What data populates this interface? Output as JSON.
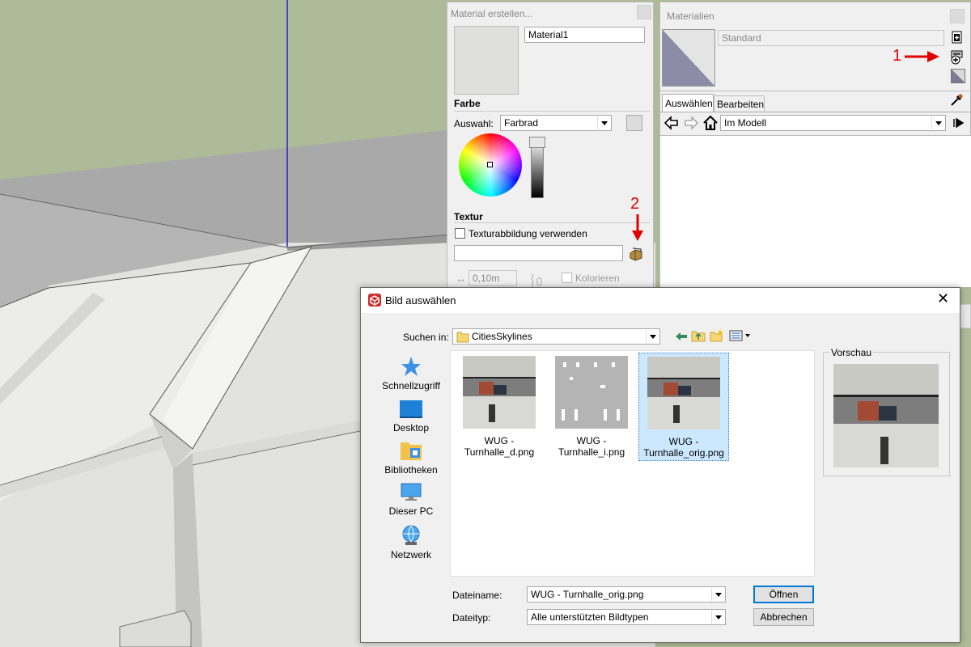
{
  "colors": {
    "viewport_sky": "#aebb98",
    "accent": "#0078d7",
    "annotation": "#e00000"
  },
  "create_material": {
    "title": "Material erstellen...",
    "name_value": "Material1",
    "color_section": "Farbe",
    "selection_label": "Auswahl:",
    "selection_value": "Farbrad",
    "texture_section": "Textur",
    "use_texture_label": "Texturabbildung verwenden",
    "texture_path_value": "",
    "size_value": "0,10m",
    "colorize_label": "Kolorieren"
  },
  "materials": {
    "title": "Materialien",
    "material_name": "Standard",
    "tabs": [
      {
        "label": "Auswählen"
      },
      {
        "label": "Bearbeiten"
      }
    ],
    "collection_value": "Im Modell"
  },
  "annotations": {
    "one": "1",
    "two": "2"
  },
  "dialog": {
    "title": "Bild auswählen",
    "look_in_label": "Suchen in:",
    "look_in_value": "CitiesSkylines",
    "places": [
      {
        "label": "Schnellzugriff",
        "icon": "star-icon"
      },
      {
        "label": "Desktop",
        "icon": "desktop-icon"
      },
      {
        "label": "Bibliotheken",
        "icon": "libraries-icon"
      },
      {
        "label": "Dieser PC",
        "icon": "computer-icon"
      },
      {
        "label": "Netzwerk",
        "icon": "network-icon"
      }
    ],
    "files": [
      {
        "line1": "WUG -",
        "line2": "Turnhalle_d.png",
        "selected": false
      },
      {
        "line1": "WUG -",
        "line2": "Turnhalle_i.png",
        "selected": false
      },
      {
        "line1": "WUG -",
        "line2": "Turnhalle_orig.png",
        "selected": true
      }
    ],
    "preview_label": "Vorschau",
    "filename_label": "Dateiname:",
    "filename_value": "WUG - Turnhalle_orig.png",
    "filetype_label": "Dateityp:",
    "filetype_value": "Alle unterstützten Bildtypen",
    "open_label": "Öffnen",
    "cancel_label": "Abbrechen"
  }
}
